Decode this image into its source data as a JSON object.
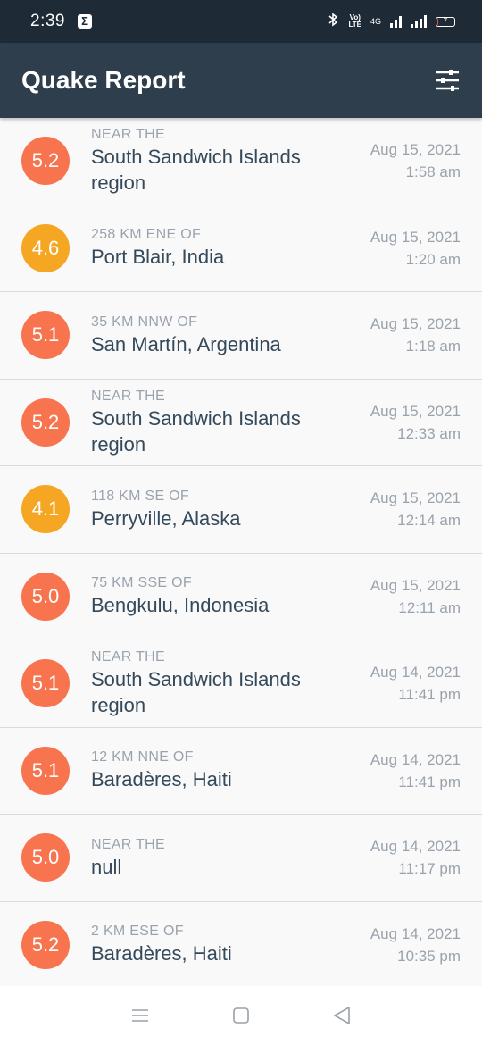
{
  "status_bar": {
    "time": "2:39",
    "sigma_icon": "Σ",
    "volte_label": "Vo)\nLTE",
    "lte_label": "4G",
    "battery_level": "7",
    "battery_fraction": 0.07
  },
  "app_bar": {
    "title": "Quake Report",
    "settings_icon": "settings-sliders-icon"
  },
  "colors": {
    "status_bar_bg": "#1e2a36",
    "app_bar_bg": "#2f3e4d",
    "mag_4": "#f5a623",
    "mag_5": "#f7744f"
  },
  "earthquakes": [
    {
      "magnitude": "5.2",
      "color": "#f7744f",
      "offset": "NEAR THE",
      "primary": "South Sandwich Islands region",
      "date": "Aug 15, 2021",
      "time": "1:58 am"
    },
    {
      "magnitude": "4.6",
      "color": "#f5a623",
      "offset": "258 KM ENE OF",
      "primary": "Port Blair, India",
      "date": "Aug 15, 2021",
      "time": "1:20 am"
    },
    {
      "magnitude": "5.1",
      "color": "#f7744f",
      "offset": "35 KM NNW OF",
      "primary": "San Martín, Argentina",
      "date": "Aug 15, 2021",
      "time": "1:18 am"
    },
    {
      "magnitude": "5.2",
      "color": "#f7744f",
      "offset": "NEAR THE",
      "primary": "South Sandwich Islands region",
      "date": "Aug 15, 2021",
      "time": "12:33 am"
    },
    {
      "magnitude": "4.1",
      "color": "#f5a623",
      "offset": "118 KM SE OF",
      "primary": "Perryville, Alaska",
      "date": "Aug 15, 2021",
      "time": "12:14 am"
    },
    {
      "magnitude": "5.0",
      "color": "#f7744f",
      "offset": "75 KM SSE OF",
      "primary": "Bengkulu, Indonesia",
      "date": "Aug 15, 2021",
      "time": "12:11 am"
    },
    {
      "magnitude": "5.1",
      "color": "#f7744f",
      "offset": "NEAR THE",
      "primary": "South Sandwich Islands region",
      "date": "Aug 14, 2021",
      "time": "11:41 pm"
    },
    {
      "magnitude": "5.1",
      "color": "#f7744f",
      "offset": "12 KM NNE OF",
      "primary": "Baradères, Haiti",
      "date": "Aug 14, 2021",
      "time": "11:41 pm"
    },
    {
      "magnitude": "5.0",
      "color": "#f7744f",
      "offset": "NEAR THE",
      "primary": "null",
      "date": "Aug 14, 2021",
      "time": "11:17 pm"
    },
    {
      "magnitude": "5.2",
      "color": "#f7744f",
      "offset": "2 KM ESE OF",
      "primary": "Baradères, Haiti",
      "date": "Aug 14, 2021",
      "time": "10:35 pm"
    }
  ],
  "nav_bar": {
    "menu_icon": "menu-icon",
    "home_icon": "home-square-icon",
    "back_icon": "back-triangle-icon"
  }
}
